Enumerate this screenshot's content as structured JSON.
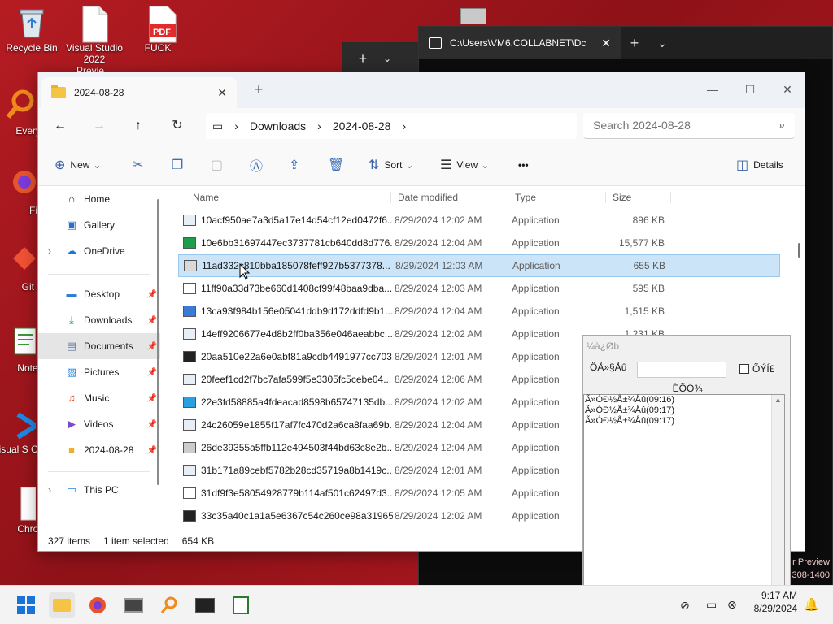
{
  "desktop": {
    "icons": [
      {
        "label": "Recycle Bin"
      },
      {
        "label": "Visual Studio 2022 Previe..."
      },
      {
        "label": "FUCK"
      },
      {
        "label": "Everyth"
      },
      {
        "label": "Firef"
      },
      {
        "label": "Git Ba"
      },
      {
        "label": "Notepa"
      },
      {
        "label": "Visual S Cod"
      },
      {
        "label": "Chromi"
      }
    ],
    "pdf_badge": "PDF",
    "watermark": [
      "r Preview",
      "308-1400"
    ]
  },
  "terminal": {
    "tab_title": "C:\\Users\\VM6.COLLABNET\\Dc",
    "add_tab": "+",
    "dropdown": "⌄"
  },
  "explorer": {
    "tab_title": "2024-08-28",
    "new_tab": "+",
    "breadcrumb": [
      "Downloads",
      "2024-08-28"
    ],
    "search_placeholder": "Search 2024-08-28",
    "toolbar": {
      "new_label": "New",
      "sort_label": "Sort",
      "view_label": "View",
      "more_label": "•••",
      "details_label": "Details"
    },
    "sidebar": {
      "top": [
        {
          "label": "Home",
          "icon": "home-icon"
        },
        {
          "label": "Gallery",
          "icon": "gallery-icon"
        },
        {
          "label": "OneDrive",
          "icon": "cloud-icon"
        }
      ],
      "quick": [
        {
          "label": "Desktop",
          "icon": "desktop-icon"
        },
        {
          "label": "Downloads",
          "icon": "download-icon"
        },
        {
          "label": "Documents",
          "icon": "documents-icon"
        },
        {
          "label": "Pictures",
          "icon": "pictures-icon"
        },
        {
          "label": "Music",
          "icon": "music-icon"
        },
        {
          "label": "Videos",
          "icon": "videos-icon"
        },
        {
          "label": "2024-08-28",
          "icon": "folder-icon"
        }
      ],
      "bottom": [
        {
          "label": "This PC",
          "icon": "pc-icon"
        }
      ]
    },
    "columns": {
      "name": "Name",
      "date": "Date modified",
      "type": "Type",
      "size": "Size"
    },
    "files": [
      {
        "name": "10acf950ae7a3d5a17e14d54cf12ed0472f6...",
        "date": "8/29/2024 12:02 AM",
        "type": "Application",
        "size": "896 KB"
      },
      {
        "name": "10e6bb31697447ec3737781cb640dd8d776...",
        "date": "8/29/2024 12:04 AM",
        "type": "Application",
        "size": "15,577 KB"
      },
      {
        "name": "11ad332c810bba185078feff927b5377378...",
        "date": "8/29/2024 12:03 AM",
        "type": "Application",
        "size": "655 KB"
      },
      {
        "name": "11ff90a33d73be660d1408cf99f48baa9dba...",
        "date": "8/29/2024 12:03 AM",
        "type": "Application",
        "size": "595 KB"
      },
      {
        "name": "13ca93f984b156e05041ddb9d172ddfd9b1...",
        "date": "8/29/2024 12:04 AM",
        "type": "Application",
        "size": "1,515 KB"
      },
      {
        "name": "14eff9206677e4d8b2ff0ba356e046aeabbc...",
        "date": "8/29/2024 12:02 AM",
        "type": "Application",
        "size": "1,231 KB"
      },
      {
        "name": "20aa510e22a6e0abf81a9cdb4491977cc703...",
        "date": "8/29/2024 12:01 AM",
        "type": "Application",
        "size": ""
      },
      {
        "name": "20feef1cd2f7bc7afa599f5e3305fc5cebe04...",
        "date": "8/29/2024 12:06 AM",
        "type": "Application",
        "size": ""
      },
      {
        "name": "22e3fd58885a4fdeacad8598b65747135db...",
        "date": "8/29/2024 12:02 AM",
        "type": "Application",
        "size": ""
      },
      {
        "name": "24c26059e1855f17af7fc470d2a6ca8faa69b...",
        "date": "8/29/2024 12:04 AM",
        "type": "Application",
        "size": ""
      },
      {
        "name": "26de39355a5ffb112e494503f44bd63c8e2b...",
        "date": "8/29/2024 12:04 AM",
        "type": "Application",
        "size": ""
      },
      {
        "name": "31b171a89cebf5782b28cd35719a8b1419c...",
        "date": "8/29/2024 12:01 AM",
        "type": "Application",
        "size": ""
      },
      {
        "name": "31df9f3e58054928779b114af501c62497d3...",
        "date": "8/29/2024 12:05 AM",
        "type": "Application",
        "size": ""
      },
      {
        "name": "33c35a40c1a1a5e6367c54c260ce98a31965...",
        "date": "8/29/2024 12:02 AM",
        "type": "Application",
        "size": ""
      }
    ],
    "status": {
      "count": "327 items",
      "selected": "1 item selected",
      "size": "654 KB"
    }
  },
  "dialog": {
    "title": "¼à¿Øb",
    "label": "ÖÅ»§Åû",
    "checkbox_label": "ÕÝÍ£",
    "group_label": "ÈÕÖ¾",
    "log": [
      "Ã»ÓÐ½Å±¾Åû(09:16)",
      "Ã»ÓÐ½Å±¾Åû(09:17)",
      "Ã»ÓÐ½Å±¾Åû(09:17)"
    ]
  },
  "taskbar": {
    "time": "9:17 AM",
    "date": "8/29/2024"
  }
}
